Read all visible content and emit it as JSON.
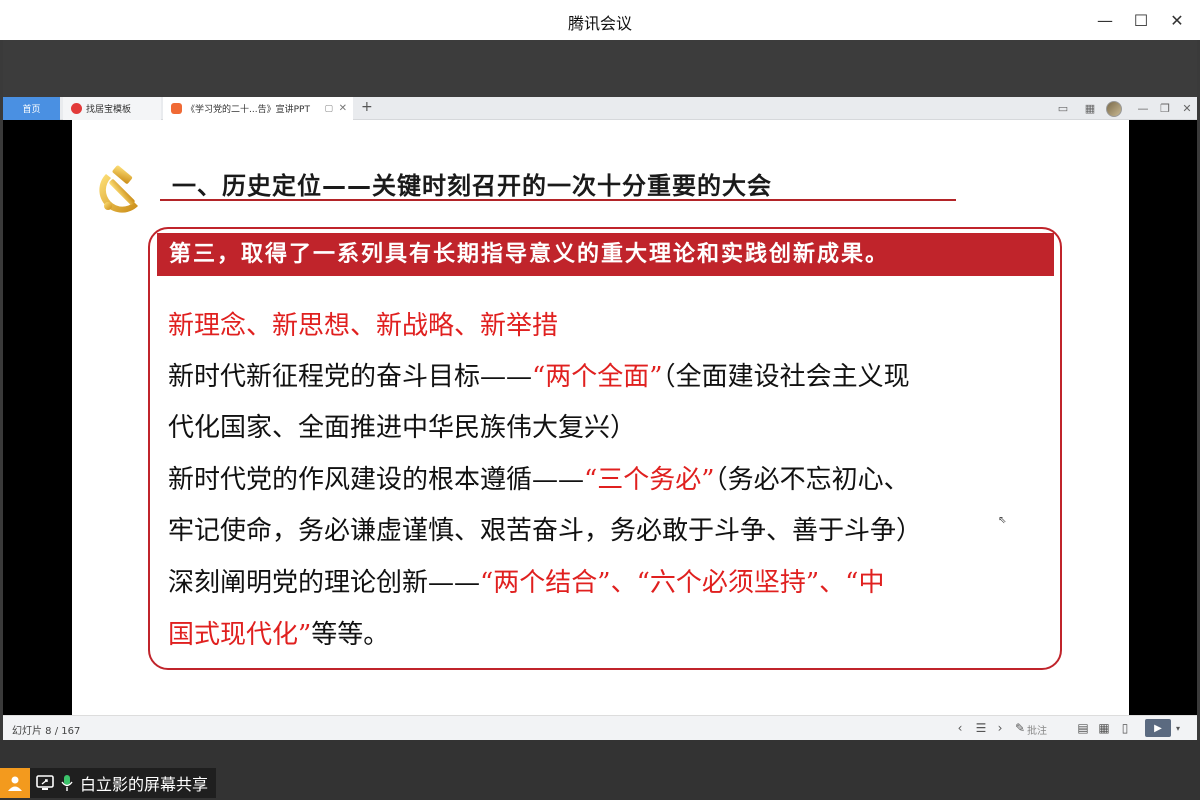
{
  "window": {
    "title": "腾讯会议",
    "controls": {
      "minimize": "—",
      "maximize": "☐",
      "close": "✕"
    }
  },
  "tabs": [
    {
      "label": "首页",
      "active": false
    },
    {
      "label": "找居宝模板",
      "active": false
    },
    {
      "label": "《学习党的二十...告》宣讲PPT",
      "active": true
    }
  ],
  "tab_new": "+",
  "slide": {
    "heading": "一、历史定位——关键时刻召开的一次十分重要的大会",
    "banner": "第三，取得了一系列具有长期指导意义的重大理论和实践创新成果。",
    "line1": "新理念、新思想、新战略、新举措",
    "line2_pre": "新时代新征程党的奋斗目标——",
    "line2_red": "“两个全面”",
    "line2_post": "（全面建设社会主义现",
    "line3": "代化国家、全面推进中华民族伟大复兴）",
    "line4_pre": "新时代党的作风建设的根本遵循——",
    "line4_red": "“三个务必”",
    "line4_post": "（务必不忘初心、",
    "line5": "牢记使命，务必谦虚谨慎、艰苦奋斗，务必敢于斗争、善于斗争）",
    "line6_pre": "深刻阐明党的理论创新——",
    "line6_red": "“两个结合”、“六个必须坚持”、“中",
    "line7_red": "国式现代化”",
    "line7_post": "等等。"
  },
  "statusbar": {
    "slide_counter": "幻灯片 8 / 167",
    "note_label": "批注"
  },
  "share": {
    "label": "白立影的屏幕共享"
  },
  "colors": {
    "accent_red": "#c0242b",
    "text_red": "#e0201f",
    "share_orange": "#f39a1e",
    "tab_active_blue": "#4a90e2"
  }
}
